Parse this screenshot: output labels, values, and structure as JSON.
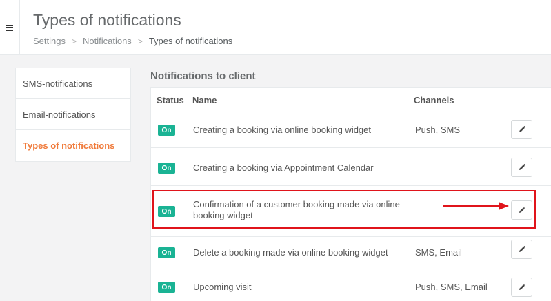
{
  "header": {
    "menu_icon": "hamburger-icon",
    "title": "Types of notifications",
    "breadcrumb": {
      "items": [
        "Settings",
        "Notifications"
      ],
      "current": "Types of notifications",
      "separator": ">"
    }
  },
  "sidebar": {
    "items": [
      {
        "label": "SMS-notifications"
      },
      {
        "label": "Email-notifications"
      },
      {
        "label": "Types of notifications"
      }
    ],
    "active_color": "#f07a3a"
  },
  "section": {
    "title": "Notifications to client"
  },
  "table": {
    "columns": {
      "status": "Status",
      "name": "Name",
      "channels": "Channels"
    },
    "rows": [
      {
        "status": "On",
        "name": "Creating a booking via online booking widget",
        "channels": "Push, SMS"
      },
      {
        "status": "On",
        "name": "Creating a booking via Appointment Calendar",
        "channels": ""
      },
      {
        "status": "On",
        "name": "Confirmation of a customer booking made via online booking widget",
        "channels": ""
      },
      {
        "status": "On",
        "name": "Delete a booking made via online booking widget",
        "channels": "SMS, Email"
      },
      {
        "status": "On",
        "name": "Upcoming visit",
        "channels": "Push, SMS, Email"
      }
    ],
    "edit_icon": "pencil-icon",
    "status_color": "#1ab394"
  },
  "annotation": {
    "color": "#e0141b"
  }
}
